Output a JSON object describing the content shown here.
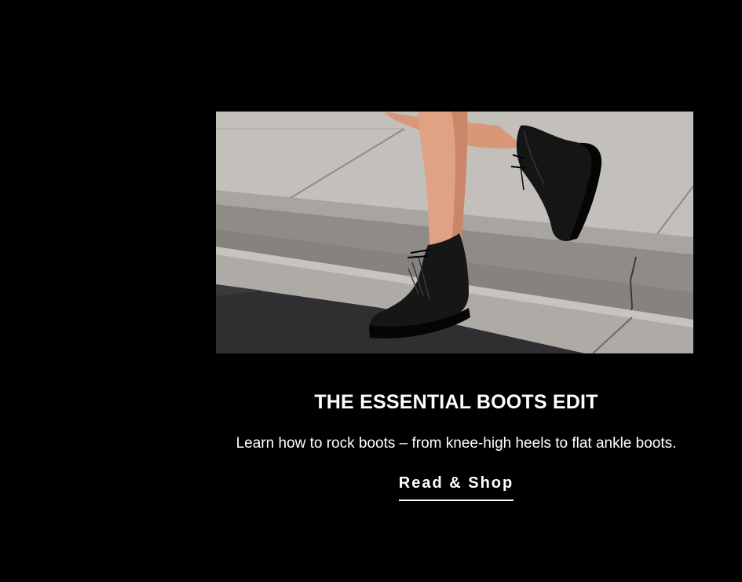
{
  "promo": {
    "image_alt": "Legs in black lace-up leather ankle boots stepping off a concrete curb",
    "title": "THE ESSENTIAL BOOTS EDIT",
    "description": "Learn how to rock boots – from knee-high heels to flat ankle boots.",
    "cta_label": "Read & Shop"
  },
  "colors": {
    "background": "#000000",
    "text": "#ffffff",
    "pavement": "#b9b6b2",
    "asphalt": "#2f2f31",
    "boot": "#141414",
    "skin": "#e0a284"
  }
}
